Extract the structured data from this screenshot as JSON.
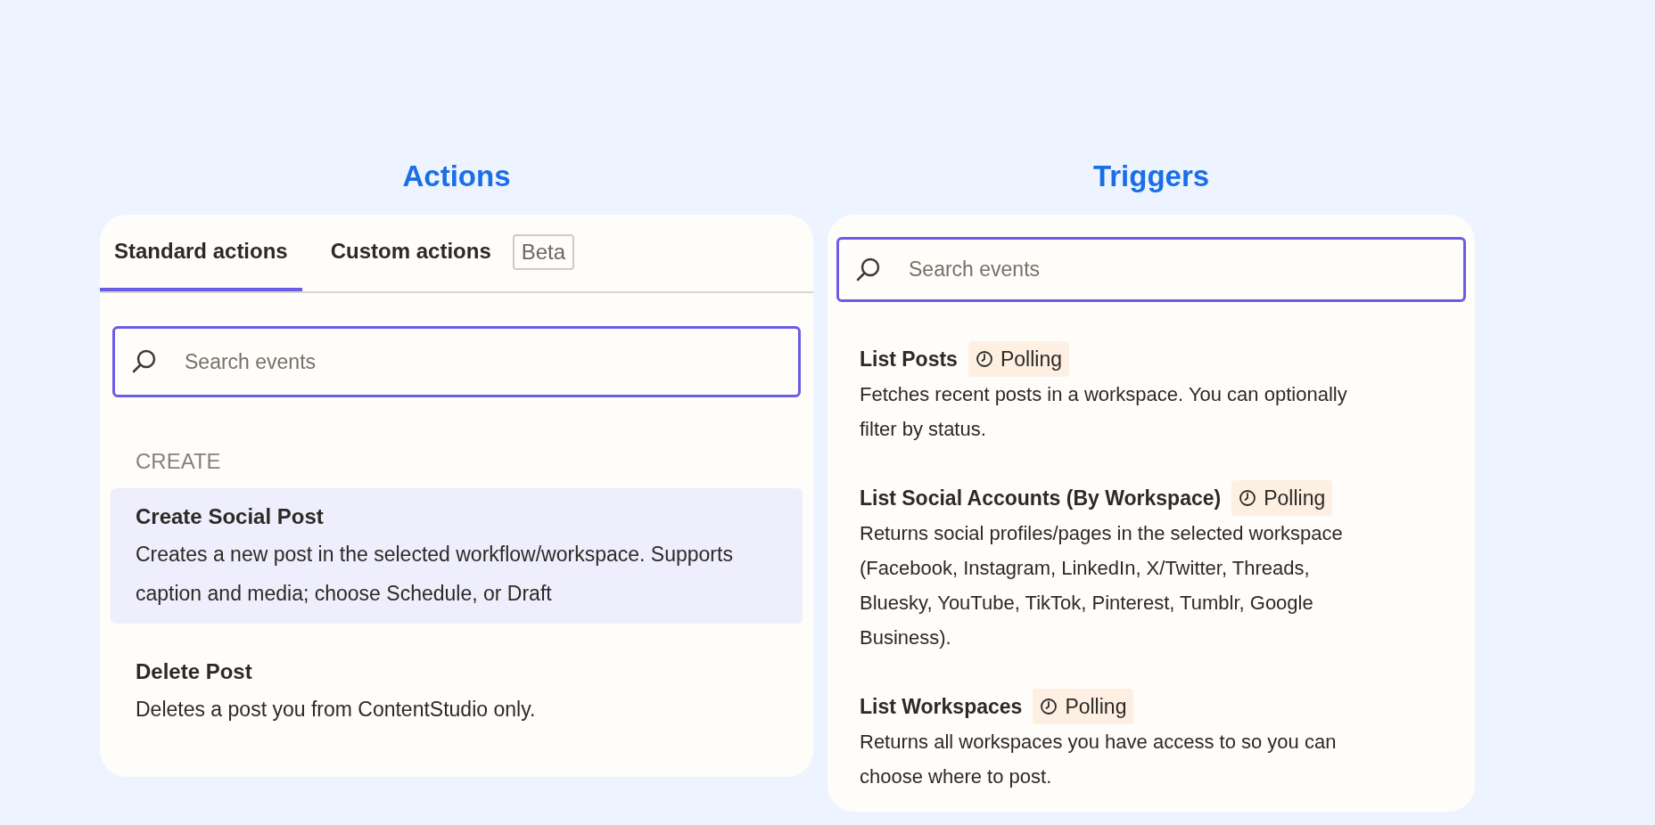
{
  "actions": {
    "title": "Actions",
    "tabs": [
      {
        "label": "Standard actions",
        "selected": true
      },
      {
        "label": "Custom actions",
        "selected": false,
        "badge": "Beta"
      }
    ],
    "search": {
      "placeholder": "Search events"
    },
    "sections": [
      {
        "heading": "CREATE",
        "items": [
          {
            "title": "Create Social Post",
            "description": "Creates a new post in the selected workflow/workspace. Supports caption and media; choose Schedule, or Draft",
            "selected": true
          },
          {
            "title": "Delete Post",
            "description": "Deletes a post you from ContentStudio only.",
            "selected": false
          }
        ]
      }
    ]
  },
  "triggers": {
    "title": "Triggers",
    "search": {
      "placeholder": "Search events"
    },
    "items": [
      {
        "title": "List Posts",
        "badge": "Polling",
        "description": "Fetches recent posts in a workspace. You can optionally filter by status."
      },
      {
        "title": "List Social Accounts (By Workspace)",
        "badge": "Polling",
        "description": "Returns social profiles/pages in the selected workspace (Facebook, Instagram, LinkedIn, X/Twitter, Threads, Bluesky, YouTube, TikTok, Pinterest, Tumblr, Google Business)."
      },
      {
        "title": "List Workspaces",
        "badge": "Polling",
        "description": "Returns all workspaces you have access to so you can choose where to post."
      }
    ]
  }
}
